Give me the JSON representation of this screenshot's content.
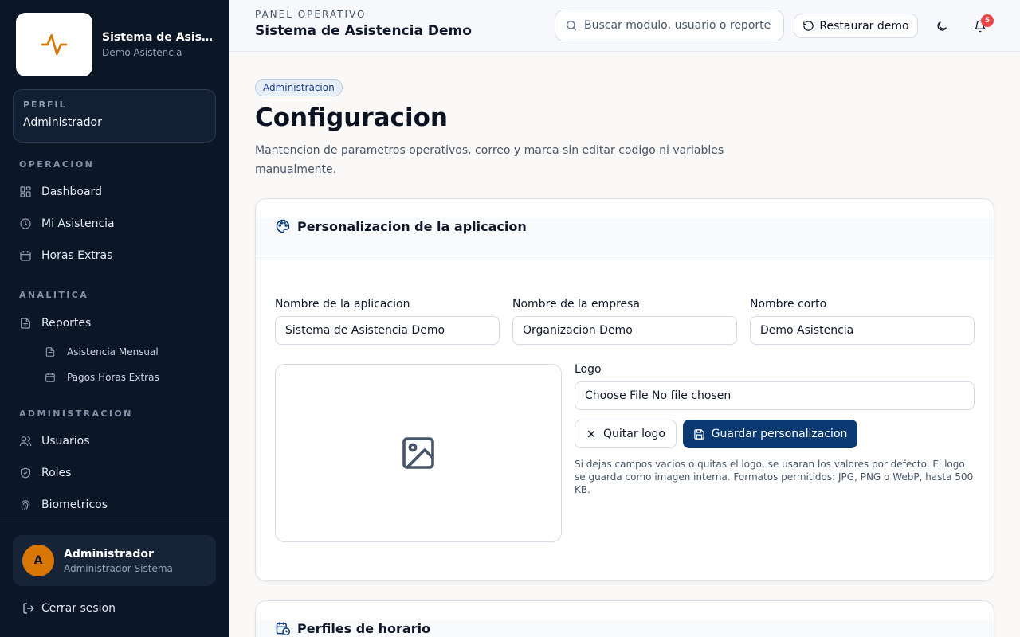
{
  "brand": {
    "title": "Sistema de Asistencia Demo",
    "subtitle": "Demo Asistencia"
  },
  "profile": {
    "label": "PERFIL",
    "value": "Administrador"
  },
  "nav": {
    "operacion_label": "OPERACION",
    "dashboard": "Dashboard",
    "mi_asistencia": "Mi Asistencia",
    "horas_extras": "Horas Extras",
    "analitica_label": "ANALITICA",
    "reportes": "Reportes",
    "asistencia_mensual": "Asistencia Mensual",
    "pagos_horas_extras": "Pagos Horas Extras",
    "administracion_label": "ADMINISTRACION",
    "usuarios": "Usuarios",
    "roles": "Roles",
    "biometricos": "Biometricos"
  },
  "user": {
    "initial": "A",
    "name": "Administrador",
    "role": "Administrador Sistema"
  },
  "logout_label": "Cerrar sesion",
  "header": {
    "kicker": "PANEL OPERATIVO",
    "title": "Sistema de Asistencia Demo",
    "search_placeholder": "Buscar modulo, usuario o reporte",
    "restore_label": "Restaurar demo",
    "notifications_count": "5"
  },
  "page": {
    "badge": "Administracion",
    "title": "Configuracion",
    "description": "Mantencion de parametros operativos, correo y marca sin editar codigo ni variables manualmente."
  },
  "personalization": {
    "title": "Personalizacion de la aplicacion",
    "app_name_label": "Nombre de la aplicacion",
    "app_name_value": "Sistema de Asistencia Demo",
    "company_label": "Nombre de la empresa",
    "company_value": "Organizacion Demo",
    "short_name_label": "Nombre corto",
    "short_name_value": "Demo Asistencia",
    "logo_label": "Logo",
    "file_input_text": "Choose File No file chosen",
    "remove_logo_label": "Quitar logo",
    "save_label": "Guardar personalizacion",
    "help_text": "Si dejas campos vacios o quitas el logo, se usaran los valores por defecto. El logo se guarda como imagen interna. Formatos permitidos: JPG, PNG o WebP, hasta 500 KB."
  },
  "schedules": {
    "title": "Perfiles de horario"
  },
  "colors": {
    "sidebar": "#0b1627",
    "accent": "#0b3a73",
    "brand_icon": "#d97706",
    "badge": "#ef4444"
  }
}
